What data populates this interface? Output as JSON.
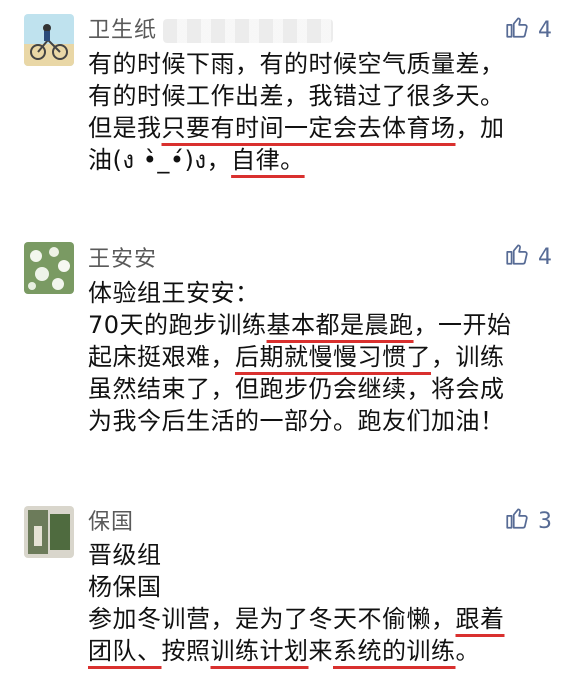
{
  "comments": [
    {
      "name": "卫生纸",
      "likes": "4",
      "lines": [
        [
          {
            "t": "有的时候下雨，有的时候空气质量差，"
          }
        ],
        [
          {
            "t": "有的时候工作出差，我错过了很多天。"
          }
        ],
        [
          {
            "t": "但是我"
          },
          {
            "t": "只要有时间一定会去体育场",
            "u": true
          },
          {
            "t": "，加"
          }
        ],
        [
          {
            "t": "油(ง •̀_•́)ง，"
          },
          {
            "t": "自律。",
            "u": true
          }
        ]
      ]
    },
    {
      "name": "王安安",
      "likes": "4",
      "lines": [
        [
          {
            "t": "体验组王安安："
          }
        ],
        [
          {
            "t": "70天的跑步训练"
          },
          {
            "t": "基本都是晨跑",
            "u": true
          },
          {
            "t": "，一开始"
          }
        ],
        [
          {
            "t": "起床挺艰难，"
          },
          {
            "t": "后期就慢慢习惯了",
            "u": true
          },
          {
            "t": "，训练"
          }
        ],
        [
          {
            "t": "虽然结束了，但跑步仍会继续，将会成"
          }
        ],
        [
          {
            "t": "为我今后生活的一部分。跑友们加油！"
          }
        ]
      ]
    },
    {
      "name": "保国",
      "likes": "3",
      "lines": [
        [
          {
            "t": "晋级组"
          }
        ],
        [
          {
            "t": "杨保国"
          }
        ],
        [
          {
            "t": "参加冬训营，是为了冬天不偷懒，"
          },
          {
            "t": "跟着",
            "u": true
          }
        ],
        [
          {
            "t": "团队、",
            "u": true
          },
          {
            "t": "按照"
          },
          {
            "t": "训练计划",
            "u": true
          },
          {
            "t": "来"
          },
          {
            "t": "系统的训练",
            "u": true
          },
          {
            "t": "。"
          }
        ]
      ]
    }
  ],
  "icons": {
    "like": "thumbs-up-icon"
  },
  "colors": {
    "accent": "#576b95",
    "underline": "#d9302e"
  }
}
